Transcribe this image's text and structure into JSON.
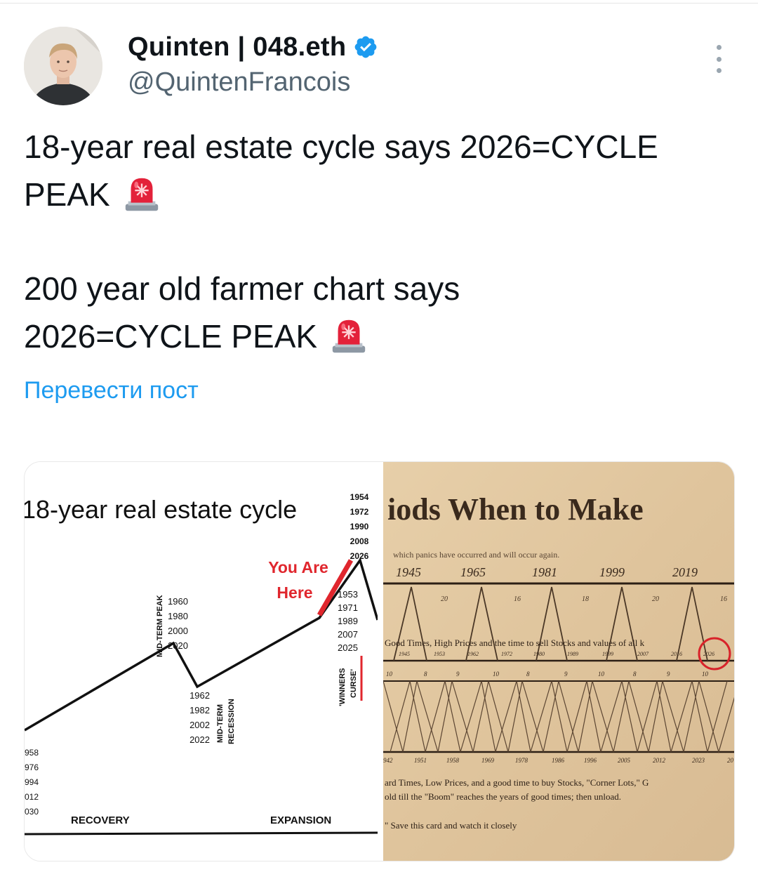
{
  "author": {
    "display_name": "Quinten | 048.eth",
    "handle": "@QuintenFrancois",
    "verified_icon": "verified-badge-icon",
    "badge_color": "#1d9bf0"
  },
  "tweet": {
    "line1": "18-year real estate cycle says 2026=CYCLE",
    "line2": "PEAK",
    "line3": "200 year old farmer chart says",
    "line4": "2026=CYCLE PEAK",
    "emoji": "rotating-light-icon",
    "translate_label": "Перевести пост"
  },
  "image_left": {
    "title": "18-year real estate cycle",
    "peak_years": [
      "1954",
      "1972",
      "1990",
      "2008",
      "2026"
    ],
    "you_are_here": [
      "You Are",
      "Here"
    ],
    "before_peak_years": [
      "1953",
      "1971",
      "1989",
      "2007",
      "2025"
    ],
    "midterm_peak_label": "MID-TERM PEAK",
    "midterm_peak_years": [
      "1960",
      "1980",
      "2000",
      "2020"
    ],
    "midterm_recession_label": [
      "MID-TERM",
      "RECESSION"
    ],
    "recession_years": [
      "1962",
      "1982",
      "2002",
      "2022"
    ],
    "winners_curse": [
      "'WINNERS",
      "CURSE'"
    ],
    "left_years": [
      "958",
      "976",
      "994",
      "012",
      "030"
    ],
    "phase_labels": [
      "RECOVERY",
      "EXPANSION"
    ]
  },
  "image_right": {
    "title": "iods When to Make",
    "subtitle": "which panics have occurred and will occur again.",
    "top_years": [
      "1945",
      "1965",
      "1981",
      "1999",
      "2019"
    ],
    "top_intervals": [
      "20",
      "16",
      "18",
      "20",
      "16"
    ],
    "good_times": "Good Times, High Prices and the time to sell Stocks and values of all k",
    "good_years": [
      "1945",
      "1953",
      "1962",
      "1972",
      "1980",
      "1989",
      "1999",
      "2007",
      "2016",
      "2026"
    ],
    "mid_nums": [
      "10",
      "8",
      "9",
      "10",
      "8",
      "9",
      "10",
      "8",
      "9",
      "10"
    ],
    "bottom_years": [
      "942",
      "1951",
      "1958",
      "1969",
      "1978",
      "1986",
      "1996",
      "2005",
      "2012",
      "2023",
      "20"
    ],
    "hard_times_line1": "ard Times, Low Prices, and a good time to buy Stocks, \"Corner Lots,\" G",
    "hard_times_line2": "old till the \"Boom\" reaches the years of good times; then unload.",
    "footer": "\" Save this card and watch it closely"
  }
}
